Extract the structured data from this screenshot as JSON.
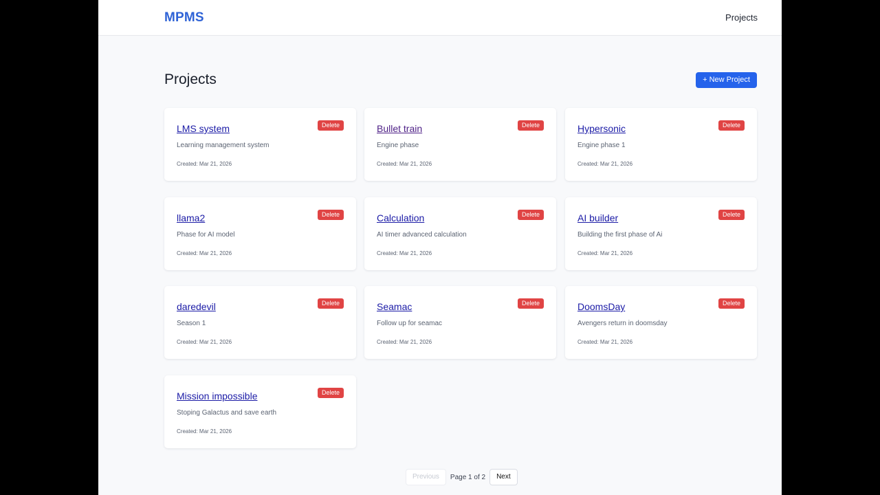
{
  "navbar": {
    "brand": "MPMS",
    "link_projects": "Projects"
  },
  "page": {
    "title": "Projects",
    "new_project_label": "+ New Project"
  },
  "projects": [
    {
      "title": "LMS system",
      "description": "Learning management system",
      "created": "Created: Mar 21, 2026",
      "delete_label": "Delete",
      "visited": false
    },
    {
      "title": "Bullet train",
      "description": "Engine phase",
      "created": "Created: Mar 21, 2026",
      "delete_label": "Delete",
      "visited": true
    },
    {
      "title": "Hypersonic",
      "description": "Engine phase 1",
      "created": "Created: Mar 21, 2026",
      "delete_label": "Delete",
      "visited": false
    },
    {
      "title": "llama2",
      "description": "Phase for AI model",
      "created": "Created: Mar 21, 2026",
      "delete_label": "Delete",
      "visited": false
    },
    {
      "title": "Calculation",
      "description": "AI timer advanced calculation",
      "created": "Created: Mar 21, 2026",
      "delete_label": "Delete",
      "visited": false
    },
    {
      "title": "AI builder",
      "description": "Building the first phase of Ai",
      "created": "Created: Mar 21, 2026",
      "delete_label": "Delete",
      "visited": false
    },
    {
      "title": "daredevil",
      "description": "Season 1",
      "created": "Created: Mar 21, 2026",
      "delete_label": "Delete",
      "visited": false
    },
    {
      "title": "Seamac",
      "description": "Follow up for seamac",
      "created": "Created: Mar 21, 2026",
      "delete_label": "Delete",
      "visited": false
    },
    {
      "title": "DoomsDay",
      "description": "Avengers return in doomsday",
      "created": "Created: Mar 21, 2026",
      "delete_label": "Delete",
      "visited": false
    },
    {
      "title": "Mission impossible",
      "description": "Stoping Galactus and save earth",
      "created": "Created: Mar 21, 2026",
      "delete_label": "Delete",
      "visited": false
    }
  ],
  "pagination": {
    "previous_label": "Previous",
    "page_label": "Page 1 of 2",
    "next_label": "Next",
    "previous_disabled": true
  },
  "colors": {
    "brand": "#2f63d6",
    "primary_button": "#2563eb",
    "delete_button": "#e04444",
    "link": "#1a1aa6",
    "link_visited": "#4d1f86"
  }
}
